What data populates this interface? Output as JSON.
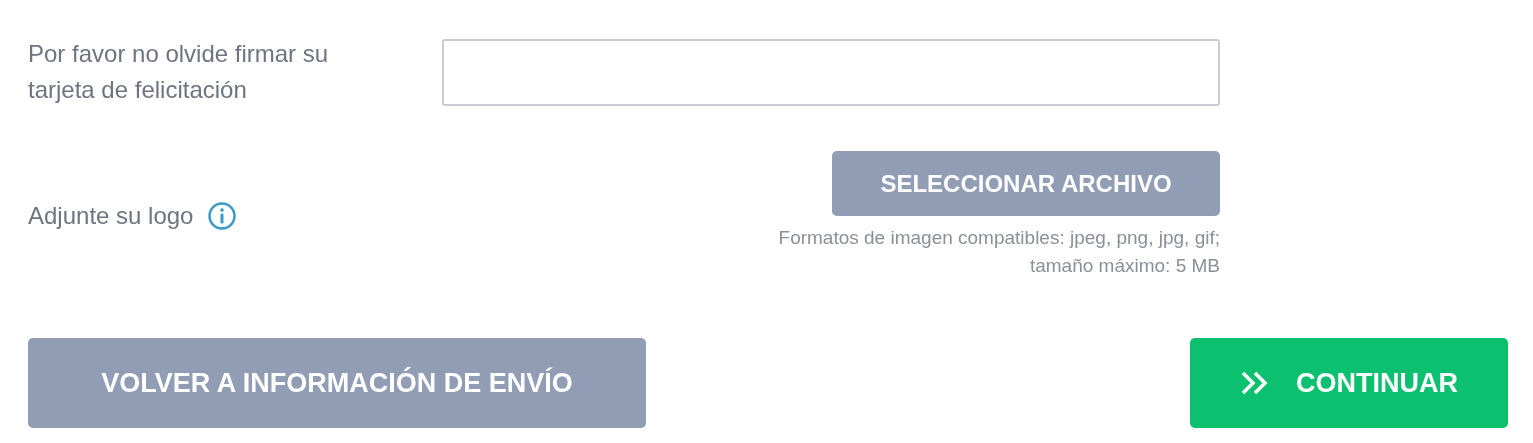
{
  "signature": {
    "label": "Por favor no olvide firmar su tarjeta de felicitación"
  },
  "logo": {
    "label": "Adjunte su logo",
    "button": "SELECCIONAR ARCHIVO",
    "hint_lines": [
      "Formatos de imagen compatibles: jpeg, png, jpg, gif;",
      "tamaño máximo: 5 MB"
    ]
  },
  "actions": [
    {
      "kind": "secondary",
      "label": "VOLVER A INFORMACIÓN DE ENVÍO"
    },
    {
      "kind": "primary",
      "label": "CONTINUAR"
    }
  ]
}
